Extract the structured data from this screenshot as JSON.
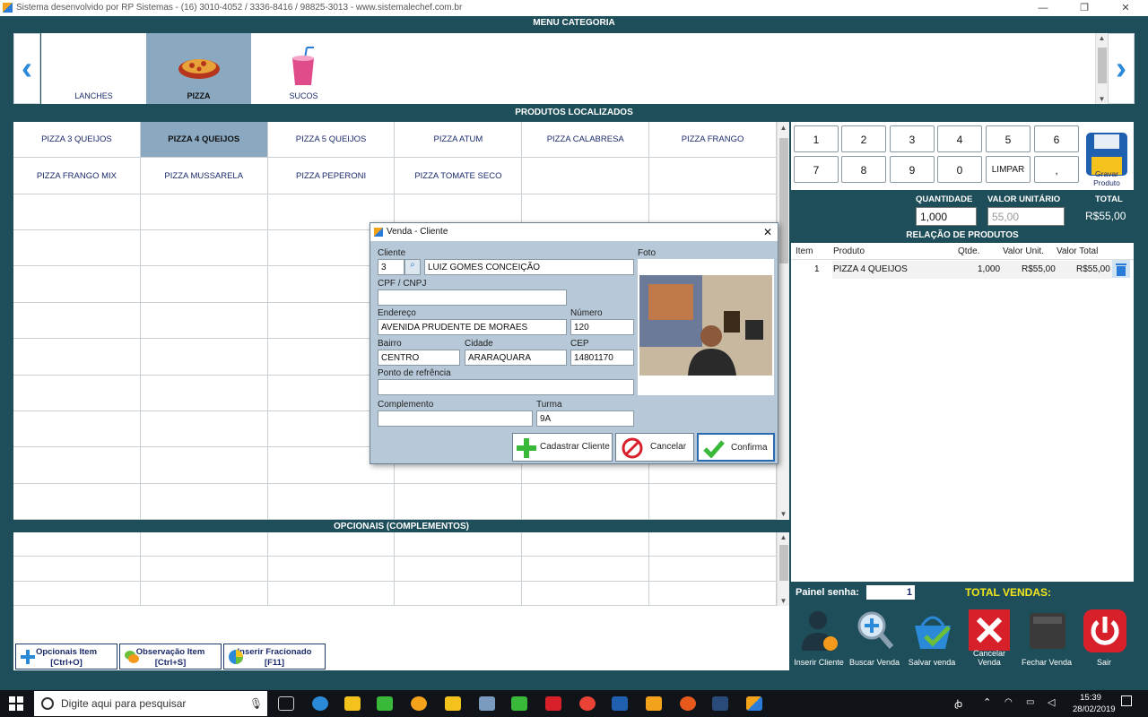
{
  "window": {
    "title": "Sistema desenvolvido por RP Sistemas - (16) 3010-4052 / 3336-8416 / 98825-3013 - www.sistemalechef.com.br",
    "minimize": "—",
    "restore": "❐",
    "close": "✕"
  },
  "menu": {
    "header": "MENU CATEGORIA",
    "prev": "‹",
    "next": "›",
    "categories": [
      {
        "label": "LANCHES",
        "icon": "burger-icon"
      },
      {
        "label": "PIZZA",
        "icon": "pizza-icon",
        "selected": true
      },
      {
        "label": "SUCOS",
        "icon": "juice-icon"
      }
    ]
  },
  "products": {
    "header": "PRODUTOS LOCALIZADOS",
    "items": [
      "PIZZA 3 QUEIJOS",
      "PIZZA 4 QUEIJOS",
      "PIZZA 5 QUEIJOS",
      "PIZZA ATUM",
      "PIZZA CALABRESA",
      "PIZZA FRANGO",
      "PIZZA FRANGO MIX",
      "PIZZA MUSSARELA",
      "PIZZA PEPERONI",
      "PIZZA TOMATE SECO"
    ],
    "selected_index": 1
  },
  "options": {
    "header": "OPCIONAIS (COMPLEMENTOS)"
  },
  "bottom_buttons": [
    {
      "label": "Opcionais Item",
      "shortcut": "[Ctrl+O]",
      "icon": "plus-icon"
    },
    {
      "label": "Observação Item",
      "shortcut": "[Ctrl+S]",
      "icon": "chat-icon"
    },
    {
      "label": "Inserir Fracionado",
      "shortcut": "[F11]",
      "icon": "pie-icon"
    }
  ],
  "keypad": {
    "row1": [
      "1",
      "2",
      "3",
      "4",
      "5",
      "6"
    ],
    "row2": [
      "7",
      "8",
      "9",
      "0",
      "LIMPAR",
      ","
    ],
    "save_label": "Gravar Produto"
  },
  "quantity": {
    "qty_label": "QUANTIDADE",
    "unit_label": "VALOR UNITÁRIO",
    "total_label": "TOTAL",
    "qty_value": "1,000",
    "unit_value": "55,00",
    "total_value": "R$55,00"
  },
  "relation": {
    "header": "RELAÇÃO DE PRODUTOS",
    "columns": [
      "Item",
      "Produto",
      "Qtde.",
      "Valor Unit.",
      "Valor Total"
    ],
    "rows": [
      {
        "item": "1",
        "produto": "PIZZA 4 QUEIJOS",
        "qtde": "1,000",
        "unit": "R$55,00",
        "total": "R$55,00"
      }
    ]
  },
  "senha": {
    "label": "Painel senha:",
    "value": "1",
    "total_label": "TOTAL VENDAS:"
  },
  "actions": [
    {
      "label": "Inserir Cliente",
      "icon": "client-icon"
    },
    {
      "label": "Buscar Venda",
      "icon": "magnifier-plus-icon"
    },
    {
      "label": "Salvar venda",
      "icon": "basket-check-icon"
    },
    {
      "label": "Cancelar Venda",
      "icon": "red-x-icon"
    },
    {
      "label": "Fechar Venda",
      "icon": "printer-icon"
    },
    {
      "label": "Sair",
      "icon": "power-icon"
    }
  ],
  "dialog": {
    "title": "Venda - Cliente",
    "cliente_label": "Cliente",
    "cliente_id": "3",
    "cliente_nome": "LUIZ GOMES CONCEIÇÃO",
    "foto_label": "Foto",
    "cpf_label": "CPF / CNPJ",
    "cpf_value": "",
    "endereco_label": "Endereço",
    "endereco_value": "AVENIDA PRUDENTE DE MORAES",
    "numero_label": "Número",
    "numero_value": "120",
    "bairro_label": "Bairro",
    "bairro_value": "CENTRO",
    "cidade_label": "Cidade",
    "cidade_value": "ARARAQUARA",
    "cep_label": "CEP",
    "cep_value": "14801170",
    "referencia_label": "Ponto de refrência",
    "referencia_value": "",
    "complemento_label": "Complemento",
    "complemento_value": "",
    "turma_label": "Turma",
    "turma_value": "9A",
    "btn_cadastrar": "Cadastrar Cliente",
    "btn_cancelar": "Cancelar",
    "btn_confirma": "Confirma",
    "close": "✕"
  },
  "taskbar": {
    "search_placeholder": "Digite aqui para pesquisar",
    "time": "15:39",
    "date": "28/02/2019"
  }
}
